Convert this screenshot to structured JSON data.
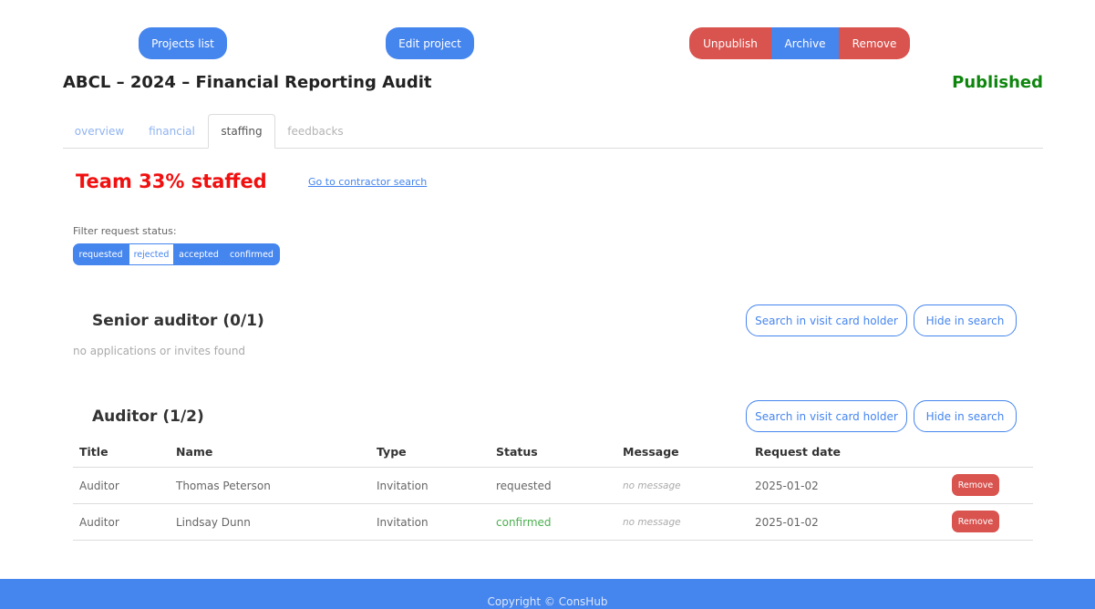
{
  "header": {
    "projects_list": "Projects list",
    "edit_project": "Edit project",
    "unpublish": "Unpublish",
    "archive": "Archive",
    "remove": "Remove"
  },
  "project": {
    "title": "ABCL – 2024 – Financial Reporting Audit",
    "status": "Published"
  },
  "tabs": [
    {
      "label": "overview"
    },
    {
      "label": "financial"
    },
    {
      "label": "staffing",
      "active": true
    },
    {
      "label": "feedbacks"
    }
  ],
  "staffing": {
    "team_status": "Team 33% staffed",
    "contractor_link": "Go to contractor search",
    "filter_label": "Filter request status:",
    "filters": [
      {
        "label": "requested"
      },
      {
        "label": "rejected",
        "selected": true
      },
      {
        "label": "accepted"
      },
      {
        "label": "confirmed"
      }
    ]
  },
  "roles": [
    {
      "title": "Senior auditor (0/1)",
      "search_btn": "Search in visit card holder",
      "hide_btn": "Hide in search",
      "empty_text": "no applications or invites found"
    },
    {
      "title": "Auditor (1/2)",
      "search_btn": "Search in visit card holder",
      "hide_btn": "Hide in search",
      "table": {
        "headers": [
          "Title",
          "Name",
          "Type",
          "Status",
          "Message",
          "Request date"
        ],
        "rows": [
          {
            "title": "Auditor",
            "name": "Thomas Peterson",
            "type": "Invitation",
            "status": "requested",
            "message": "no message",
            "date": "2025-01-02",
            "action": "Remove"
          },
          {
            "title": "Auditor",
            "name": "Lindsay Dunn",
            "type": "Invitation",
            "status": "confirmed",
            "message": "no message",
            "date": "2025-01-02",
            "action": "Remove"
          }
        ]
      }
    }
  ],
  "footer": {
    "copyright": "Copyright © ConsHub"
  },
  "colors": {
    "primary": "#4585ee",
    "danger": "#d9534f",
    "published": "#0e860e",
    "staffed_alert": "#f01010",
    "confirmed": "#4caf50"
  }
}
